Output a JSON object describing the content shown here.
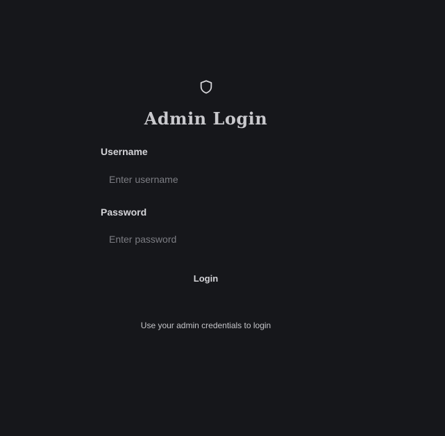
{
  "login": {
    "icon": "shield-icon",
    "title": "Admin Login",
    "username": {
      "label": "Username",
      "value": "",
      "placeholder": "Enter username"
    },
    "password": {
      "label": "Password",
      "value": "",
      "placeholder": "Enter password"
    },
    "submit_label": "Login",
    "hint": "Use your admin credentials to login"
  },
  "colors": {
    "background": "#16171b",
    "text": "#d4d4d8",
    "placeholder": "#7c7d83"
  }
}
